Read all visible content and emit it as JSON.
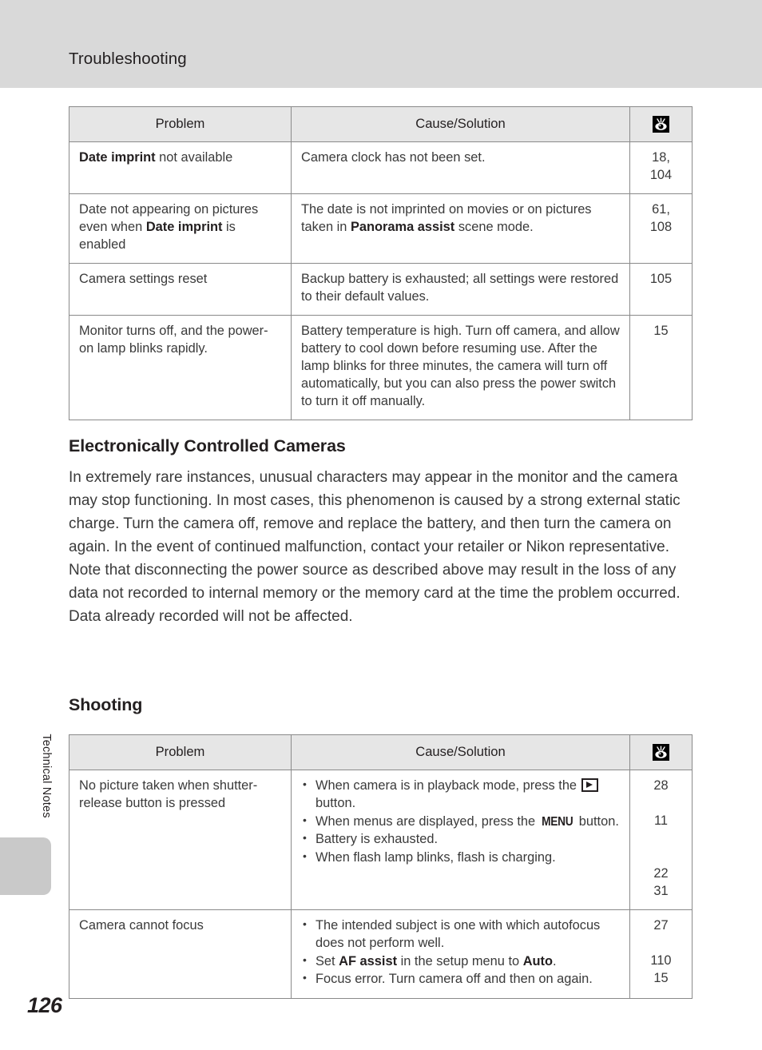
{
  "page": {
    "header_title": "Troubleshooting",
    "page_number": "126",
    "side_tab_label": "Technical Notes",
    "colors": {
      "header_band": "#d9d9d9",
      "table_header_fill": "#e6e6e6",
      "table_rule": "#8a8a8a",
      "side_tab": "#c9c9c9",
      "body_text": "#3a3a3a"
    }
  },
  "table_one": {
    "columns": [
      "Problem",
      "Cause/Solution",
      "reference-eye-icon"
    ],
    "rows": [
      {
        "problem_bold": "Date imprint",
        "problem_rest": " not available",
        "cause": "Camera clock has not been set.",
        "refs": [
          "18,",
          "104"
        ]
      },
      {
        "problem_pre": "Date not appearing on pictures even when ",
        "problem_bold": "Date imprint",
        "problem_post": " is enabled",
        "cause_pre": "The date is not imprinted on movies or on pictures taken in ",
        "cause_bold": "Panorama assist",
        "cause_post": " scene mode.",
        "refs": [
          "61, 108"
        ]
      },
      {
        "problem": "Camera settings reset",
        "cause": "Backup battery is exhausted; all settings were restored to their default values.",
        "refs": [
          "105"
        ]
      },
      {
        "problem": "Monitor turns off, and the power-on lamp blinks rapidly.",
        "cause": "Battery temperature is high. Turn off camera, and allow battery to cool down before resuming use. After the lamp blinks for three minutes, the camera will turn off automatically, but you can also press the power switch to turn it off manually.",
        "refs": [
          "15"
        ]
      }
    ]
  },
  "electronically_controlled_cameras": {
    "heading": "Electronically Controlled Cameras",
    "body": "In extremely rare instances, unusual characters may appear in the monitor and the camera may stop functioning. In most cases, this phenomenon is caused by a strong external static charge. Turn the camera off, remove and replace the battery, and then turn the camera on again. In the event of continued malfunction, contact your retailer or Nikon representative. Note that disconnecting the power source as described above may result in the loss of any data not recorded to internal memory or the memory card at the time the problem occurred. Data already recorded will not be affected."
  },
  "shooting": {
    "heading": "Shooting",
    "table": {
      "columns": [
        "Problem",
        "Cause/Solution",
        "reference-eye-icon"
      ],
      "rows": [
        {
          "problem": "No picture taken when shutter-release button is pressed",
          "bullets": [
            {
              "pre": "When camera is in playback mode, press the ",
              "icon": "playback-button-icon",
              "post": " button.",
              "ref": "28"
            },
            {
              "pre": "When menus are displayed, press the ",
              "glyph": "MENU",
              "post": " button.",
              "ref": "11"
            },
            {
              "pre": "Battery is exhausted.",
              "ref": "22"
            },
            {
              "pre": "When flash lamp blinks, flash is charging.",
              "ref": "31"
            }
          ]
        },
        {
          "problem": "Camera cannot focus",
          "bullets": [
            {
              "pre": "The intended subject is one with which autofocus does not perform well.",
              "ref": "27"
            },
            {
              "pre": "Set ",
              "bold": "AF assist",
              "mid": " in the setup menu to ",
              "bold2": "Auto",
              "post": ".",
              "ref": "110"
            },
            {
              "pre": "Focus error. Turn camera off and then on again.",
              "ref": "15"
            }
          ]
        }
      ]
    }
  }
}
